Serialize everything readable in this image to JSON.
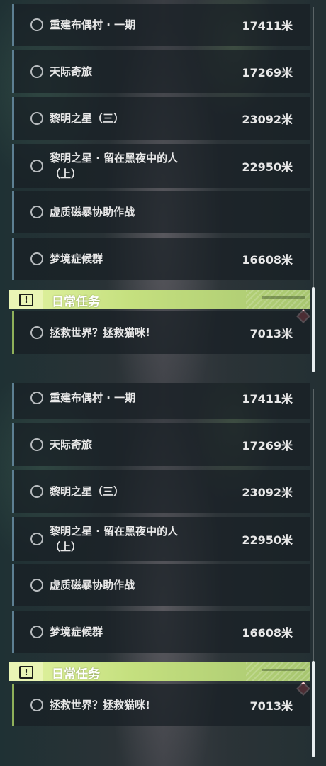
{
  "panels": [
    {
      "quests": [
        {
          "title": "重建布偶村 · 一期",
          "distance": "17411米"
        },
        {
          "title": "天际奇旅",
          "distance": "17269米"
        },
        {
          "title": "黎明之星（三）",
          "distance": "23092米"
        },
        {
          "title": "黎明之星 · 留在黑夜中的人（上）",
          "distance": "22950米"
        },
        {
          "title": "虚质磁暴协助作战",
          "distance": ""
        },
        {
          "title": "梦境症候群",
          "distance": "16608米"
        }
      ],
      "section_title": "日常任务",
      "daily_quests": [
        {
          "title": "拯救世界？拯救猫咪!",
          "distance": "7013米"
        }
      ]
    },
    {
      "quests": [
        {
          "title": "重建布偶村 · 一期",
          "distance": "17411米"
        },
        {
          "title": "天际奇旅",
          "distance": "17269米"
        },
        {
          "title": "黎明之星（三）",
          "distance": "23092米"
        },
        {
          "title": "黎明之星 · 留在黑夜中的人（上）",
          "distance": "22950米"
        },
        {
          "title": "虚质磁暴协助作战",
          "distance": ""
        },
        {
          "title": "梦境症候群",
          "distance": "16608米"
        }
      ],
      "section_title": "日常任务",
      "daily_quests": [
        {
          "title": "拯救世界？拯救猫咪!",
          "distance": "7013米"
        }
      ]
    }
  ],
  "icons": {
    "section": "exclamation-box-icon",
    "tracked": "red-diamond-marker-icon",
    "quest": "radio-circle-icon"
  },
  "colors": {
    "section_header": "#c5e07f",
    "quest_accent": "#5d7f92",
    "daily_accent": "#8fb05a",
    "marker": "#d2545d"
  }
}
